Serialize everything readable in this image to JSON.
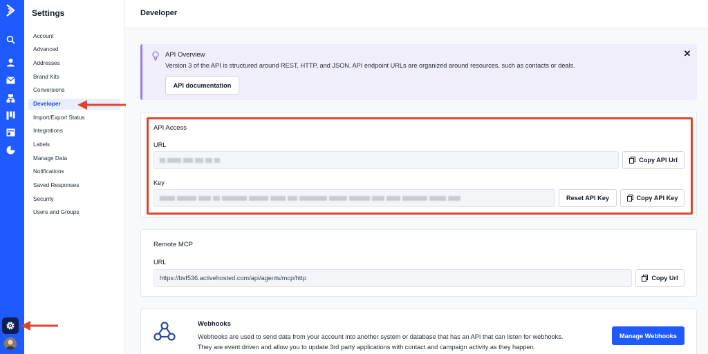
{
  "colors": {
    "accent": "#1f5aff",
    "highlight": "#e0432b",
    "overview_bg": "#f1eefb"
  },
  "rail": {
    "icons": [
      "activecampaign-logo-icon",
      "search-icon",
      "contacts-icon",
      "email-icon",
      "automations-icon",
      "pipelines-icon",
      "site-icon",
      "reports-icon"
    ],
    "bottom": [
      "gear-icon",
      "avatar"
    ]
  },
  "sidebar": {
    "title": "Settings",
    "items": [
      {
        "label": "Account"
      },
      {
        "label": "Advanced"
      },
      {
        "label": "Addresses"
      },
      {
        "label": "Brand Kits"
      },
      {
        "label": "Conversions"
      },
      {
        "label": "Developer",
        "active": true
      },
      {
        "label": "Import/Export Status"
      },
      {
        "label": "Integrations"
      },
      {
        "label": "Labels"
      },
      {
        "label": "Manage Data"
      },
      {
        "label": "Notifications"
      },
      {
        "label": "Saved Responses"
      },
      {
        "label": "Security"
      },
      {
        "label": "Users and Groups"
      }
    ]
  },
  "header": {
    "title": "Developer"
  },
  "overview": {
    "title": "API Overview",
    "text": "Version 3 of the API is structured around REST, HTTP, and JSON. API endpoint URLs are organized around resources, such as contacts or deals.",
    "button": "API documentation"
  },
  "api_access": {
    "title": "API Access",
    "url_label": "URL",
    "copy_url_button": "Copy API Url",
    "key_label": "Key",
    "reset_button": "Reset API Key",
    "copy_key_button": "Copy API Key"
  },
  "remote_mcp": {
    "title": "Remote MCP",
    "url_label": "URL",
    "url_value": "https://bsf536.activehosted.com/api/agents/mcp/http",
    "copy_button": "Copy Url"
  },
  "webhooks": {
    "title": "Webhooks",
    "text_line1": "Webhooks are used to send data from your account into another system or database that has an API that can listen for webhooks.",
    "text_line2": "They are event driven and allow you to update 3rd party applications with contact and campaign activity as they happen.",
    "button": "Manage Webhooks"
  }
}
